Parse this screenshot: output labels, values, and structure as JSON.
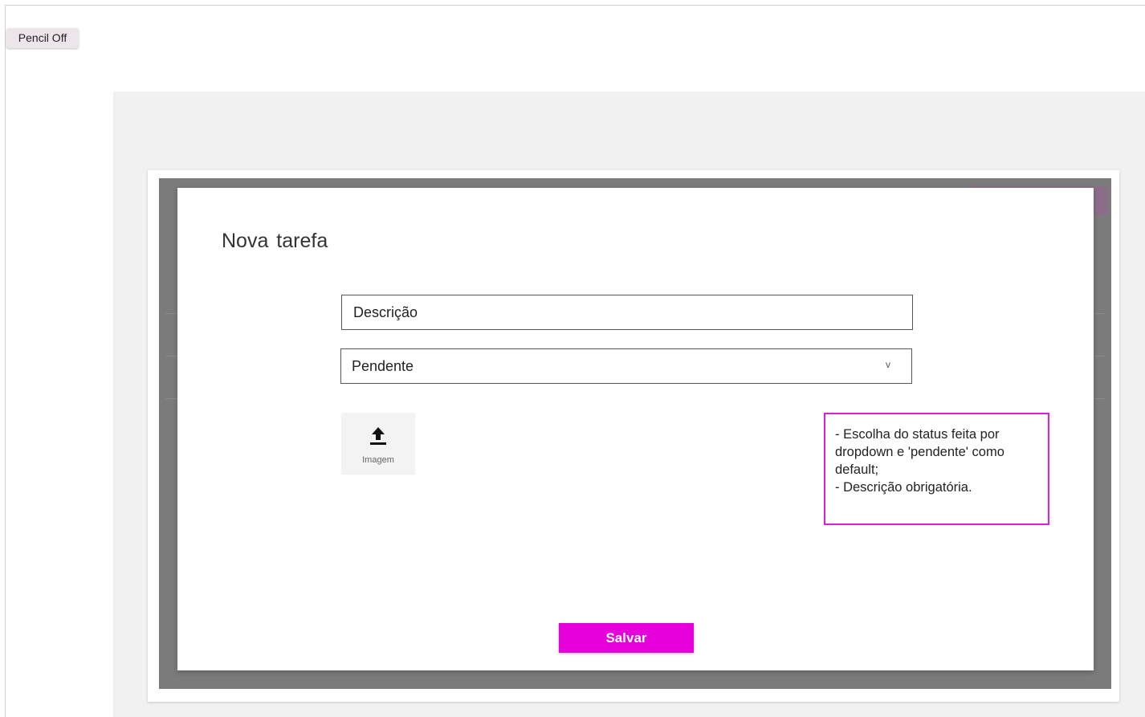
{
  "toolbar": {
    "pencil_toggle_label": "Pencil Off"
  },
  "dialog": {
    "title": "Nova  tarefa",
    "description_field": {
      "placeholder": "Descrição",
      "value": ""
    },
    "status_select": {
      "selected": "Pendente",
      "arrow_glyph": "v"
    },
    "image_upload": {
      "label": "Imagem",
      "icon": "upload-icon"
    },
    "save_label": "Salvar"
  },
  "annotation": {
    "text": "- Escolha do status feita por dropdown e 'pendente' como default;\n- Descrição obrigatória."
  },
  "colors": {
    "accent": "#e600da",
    "annotation_border": "#e11cd8",
    "overlay": "#7b7b7b"
  }
}
